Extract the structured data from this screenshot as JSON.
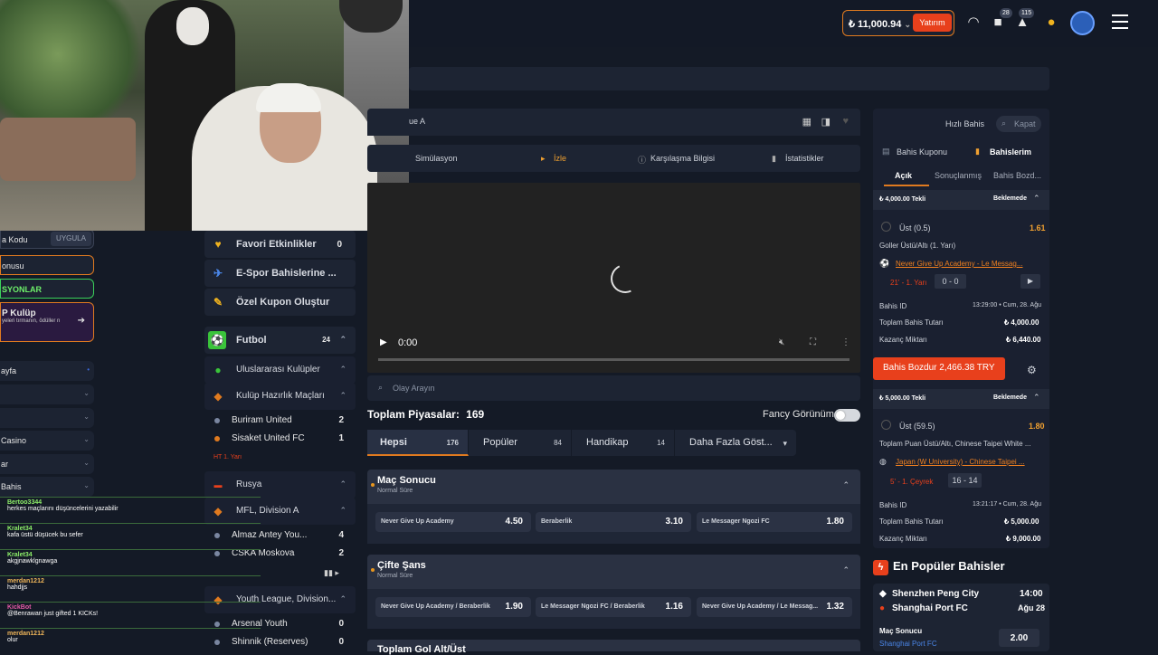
{
  "topbar": {
    "balance": "₺ 11,000.94",
    "deposit_label": "Yatırım",
    "gift_count": "28",
    "notif_count": "115"
  },
  "left_partial": {
    "promo_code": "a Kodu",
    "apply": "UYGULA",
    "bonus": "onusu",
    "promotions": "SYONLAR",
    "vip_title": "P Kulüp",
    "vip_sub": "yeleri tırmanın, ödüller n",
    "items": [
      "ayfa",
      "",
      "",
      "Casino",
      "ar",
      "Bahis"
    ]
  },
  "sidebar": {
    "favorites": {
      "label": "Favori Etkinlikler",
      "count": "0"
    },
    "esports": "E-Spor Bahislerine ...",
    "custom_coupon": "Özel Kupon Oluştur",
    "football": {
      "label": "Futbol",
      "count": "24"
    },
    "intl_clubs": "Uluslararası Kulüpler",
    "club_friendlies": "Kulüp Hazırlık Maçları",
    "teams1": [
      {
        "name": "Buriram United",
        "score": "2"
      },
      {
        "name": "Sisaket United FC",
        "score": "1"
      }
    ],
    "live1": "HT 1. Yarı",
    "russia": "Rusya",
    "division": "MFL, Division A",
    "teams2": [
      {
        "name": "Almaz Antey You...",
        "score": "4"
      },
      {
        "name": "CSKA Moskova",
        "score": "2"
      }
    ],
    "youth": "Youth League, Division...",
    "teams3": [
      {
        "name": "Arsenal Youth",
        "score": "0"
      },
      {
        "name": "Shinnik (Reserves)",
        "score": "0"
      }
    ]
  },
  "match": {
    "league": "ue A",
    "tabs": [
      "Simülasyon",
      "İzle",
      "Karşılaşma Bilgisi",
      "İstatistikler"
    ],
    "video_time": "0:00",
    "event_search_placeholder": "Olay Arayın",
    "total_label": "Toplam Piyasalar:",
    "total_count": "169",
    "fancy_label": "Fancy Görünüm",
    "filters": [
      {
        "label": "Hepsi",
        "count": "176"
      },
      {
        "label": "Popüler",
        "count": "84"
      },
      {
        "label": "Handikap",
        "count": "14"
      },
      {
        "label": "Daha Fazla Göst...",
        "count": ""
      }
    ],
    "markets": [
      {
        "title": "Maç Sonucu",
        "sub": "Normal Süre",
        "odds": [
          {
            "label": "Never Give Up Academy",
            "value": "4.50"
          },
          {
            "label": "Beraberlik",
            "value": "3.10"
          },
          {
            "label": "Le Messager Ngozi FC",
            "value": "1.80"
          }
        ]
      },
      {
        "title": "Çifte Şans",
        "sub": "Normal Süre",
        "odds": [
          {
            "label": "Never Give Up Academy / Beraberlik",
            "value": "1.90"
          },
          {
            "label": "Le Messager Ngozi FC / Beraberlik",
            "value": "1.16"
          },
          {
            "label": "Never Give Up Academy / Le Messag...",
            "value": "1.32"
          }
        ]
      }
    ],
    "next_market": "Toplam Gol Alt/Üst"
  },
  "slip": {
    "quick_bet": "Hızlı Bahis",
    "close": "Kapat",
    "coupon_tab": "Bahis Kuponu",
    "mybets_tab": "Bahislerim",
    "sub_tabs": [
      "Açık",
      "Sonuçlanmış",
      "Bahis Bozd..."
    ],
    "bets": [
      {
        "header": "₺ 4,000.00 Tekli",
        "status": "Beklemede",
        "selection": "Üst (0.5)",
        "odds": "1.61",
        "market": "Goller Üstü/Altı (1. Yarı)",
        "event": "Never Give Up Academy - Le Messag...",
        "live": "21' - 1. Yarı",
        "score": "0 - 0",
        "id_label": "Bahis ID",
        "datetime": "13:29:00 • Cum, 28. Ağu",
        "stake_label": "Toplam Bahis Tutarı",
        "stake": "₺ 4,000.00",
        "win_label": "Kazanç Miktarı",
        "win": "₺ 6,440.00"
      },
      {
        "header": "₺ 5,000.00 Tekli",
        "status": "Beklemede",
        "selection": "Üst (59.5)",
        "odds": "1.80",
        "market": "Toplam Puan Üstü/Altı, Chinese Taipei White ...",
        "event": "Japan (W University) - Chinese Taipei ...",
        "live": "5' - 1. Çeyrek",
        "score": "16 - 14",
        "id_label": "Bahis ID",
        "datetime": "13:21:17 • Cum, 28. Ağu",
        "stake_label": "Toplam Bahis Tutarı",
        "stake": "₺ 5,000.00",
        "win_label": "Kazanç Miktarı",
        "win": "₺ 9,000.00"
      }
    ],
    "cashout": "Bahis Bozdur 2,466.38 TRY"
  },
  "popular": {
    "title": "En Popüler Bahisler",
    "team1": "Shenzhen Peng City",
    "team2": "Shanghai Port FC",
    "time": "14:00",
    "date": "Ağu 28",
    "market": "Maç Sonucu",
    "pick": "Shanghai Port FC",
    "odds": "2.00"
  },
  "chat": [
    {
      "user": "Bertoo3344",
      "msg": "herkes maçlarını düşüncelerini yazabilir"
    },
    {
      "user": "Kralet34",
      "msg": "kafa üstü düşücek bu sefer"
    },
    {
      "user": "Kralet34",
      "msg": "akgjnawklgnawga"
    },
    {
      "user": "merdan1212",
      "msg": "hahdjjs"
    },
    {
      "user": "KickBot",
      "msg": "@Benrawan just gifted 1 KICKs!"
    },
    {
      "user": "merdan1212",
      "msg": "olur"
    }
  ],
  "colors": {
    "accent": "#e07a1f",
    "danger": "#e8401c",
    "bg": "#141a26",
    "panel": "#1d2433"
  }
}
